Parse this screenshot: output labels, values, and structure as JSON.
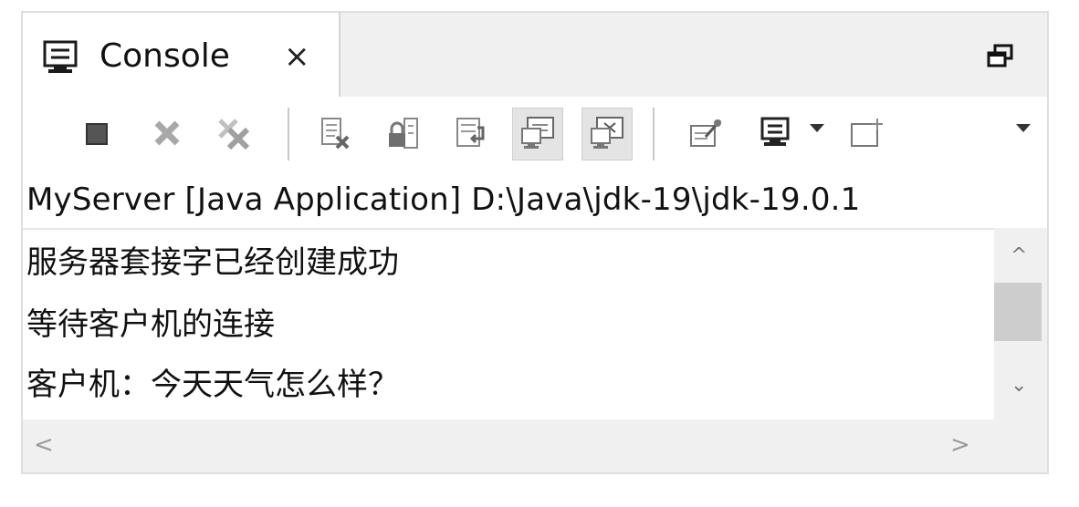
{
  "tab": {
    "label": "Console",
    "close_glyph": "×",
    "icon": "console-icon"
  },
  "window_controls": {
    "restore_icon": "restore-icon"
  },
  "toolbar": {
    "buttons": [
      {
        "icon": "terminate-icon",
        "pressed": false
      },
      {
        "icon": "remove-launch-icon",
        "pressed": false
      },
      {
        "icon": "remove-all-terminated-icon",
        "pressed": false
      },
      {
        "icon": "clear-console-icon",
        "pressed": false
      },
      {
        "icon": "scroll-lock-icon",
        "pressed": false
      },
      {
        "icon": "word-wrap-icon",
        "pressed": false
      },
      {
        "icon": "show-console-on-stdout-icon",
        "pressed": true
      },
      {
        "icon": "show-console-on-stderr-icon",
        "pressed": true
      },
      {
        "icon": "pin-console-icon",
        "pressed": false
      },
      {
        "icon": "display-selected-console-icon",
        "pressed": false
      },
      {
        "icon": "open-console-icon",
        "pressed": false
      }
    ]
  },
  "process_title": "MyServer [Java Application] D:\\Java\\jdk-19\\jdk-19.0.1",
  "output": {
    "lines": [
      "服务器套接字已经创建成功",
      "等待客户机的连接",
      "客户机：今天天气怎么样？"
    ]
  },
  "scrollbars": {
    "up_glyph": "^",
    "down_glyph": "⌄",
    "left_glyph": "<",
    "right_glyph": ">"
  }
}
